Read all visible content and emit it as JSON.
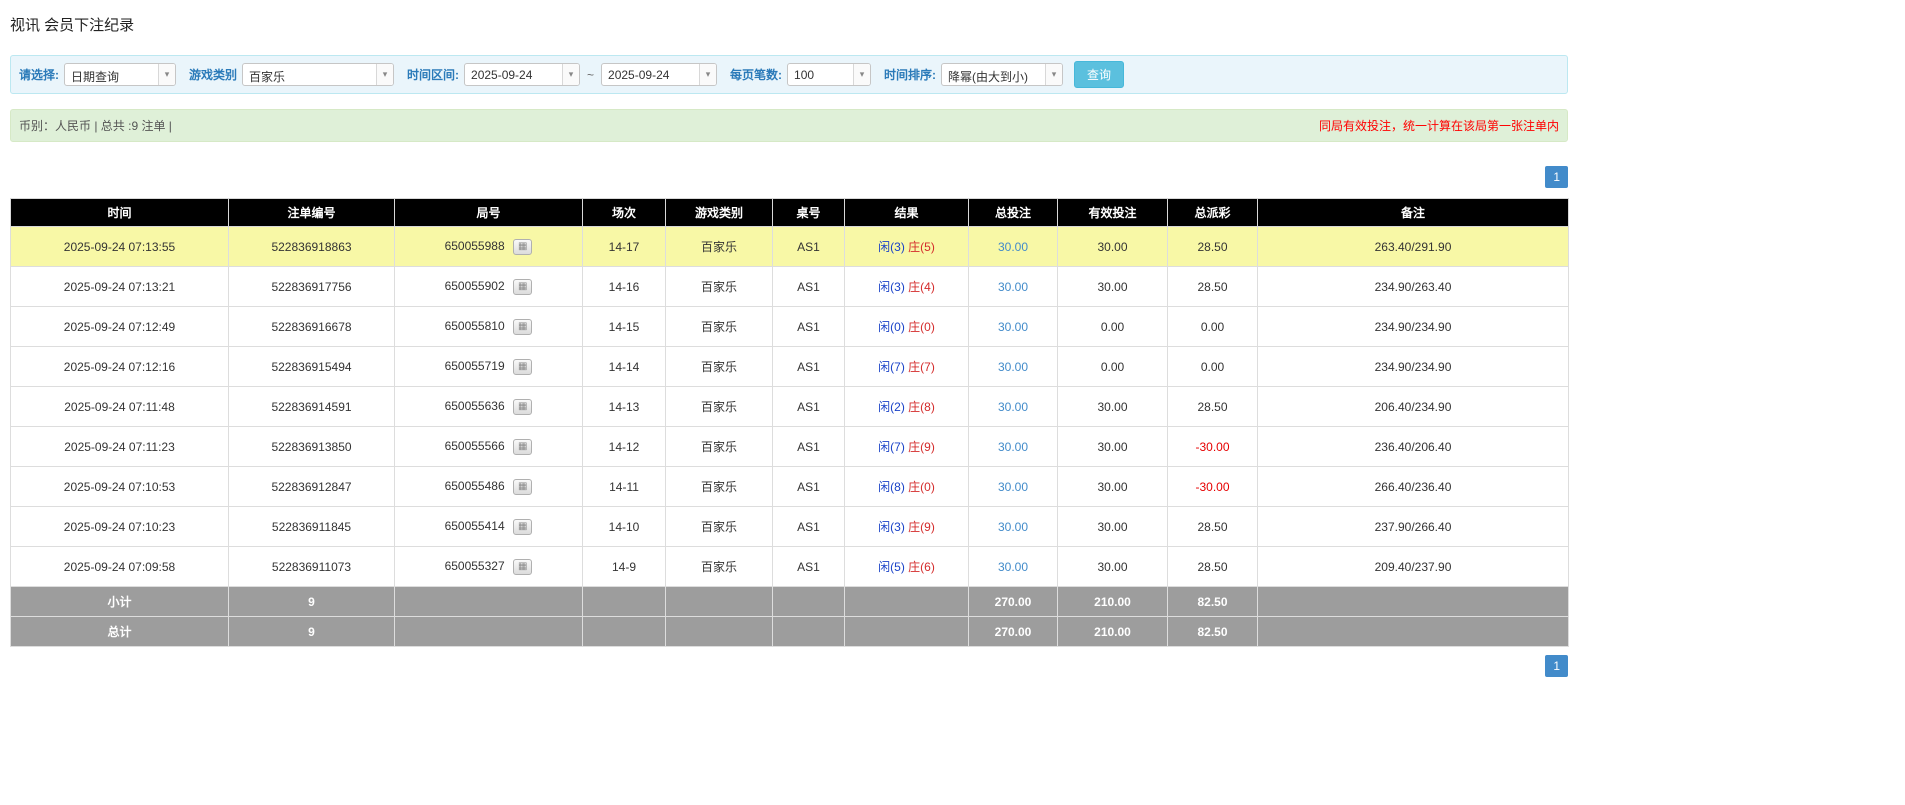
{
  "colors": {
    "accent": "#428bca",
    "button": "#5bc0de",
    "button_border": "#46b8da",
    "filter_bg": "#eaf5fb",
    "filter_border": "#bce8f1",
    "filter_label": "#2a7ab9",
    "summary_bg": "#dff0d8",
    "summary_border": "#d6e9c6",
    "note_red": "#ff0000",
    "highlight": "#f8f8a6",
    "player_blue": "#1a42c8",
    "banker_red": "#d42b2b",
    "footer_bg": "#9d9d9d",
    "header_bg": "#000000"
  },
  "page": {
    "title": "视讯 会员下注纪录"
  },
  "filters": {
    "select_label": "请选择:",
    "select_value": "日期查询",
    "game_type_label": "游戏类别",
    "game_type_value": "百家乐",
    "time_range_label": "时间区间:",
    "time_from": "2025-09-24",
    "range_separator": "~",
    "time_to": "2025-09-24",
    "page_size_label": "每页笔数:",
    "page_size_value": "100",
    "sort_label": "时间排序:",
    "sort_value": "降幂(由大到小)",
    "search_button": "查询"
  },
  "summary_bar": {
    "left": "币别：人民币 | 总共 :9 注单 |",
    "right": "同局有效投注，统一计算在该局第一张注单内"
  },
  "pagination": {
    "page": "1"
  },
  "table": {
    "headers": [
      "时间",
      "注单编号",
      "局号",
      "场次",
      "游戏类别",
      "桌号",
      "结果",
      "总投注",
      "有效投注",
      "总派彩",
      "备注"
    ],
    "rows": [
      {
        "time": "2025-09-24 07:13:55",
        "bet_id": "522836918863",
        "round_no": "650055988",
        "session": "14-17",
        "game_type": "百家乐",
        "table_no": "AS1",
        "result_player": "闲(3)",
        "result_banker": "庄(5)",
        "total_bet": "30.00",
        "valid_bet": "30.00",
        "payout": "28.50",
        "remark": "263.40/291.90",
        "highlight": true
      },
      {
        "time": "2025-09-24 07:13:21",
        "bet_id": "522836917756",
        "round_no": "650055902",
        "session": "14-16",
        "game_type": "百家乐",
        "table_no": "AS1",
        "result_player": "闲(3)",
        "result_banker": "庄(4)",
        "total_bet": "30.00",
        "valid_bet": "30.00",
        "payout": "28.50",
        "remark": "234.90/263.40",
        "highlight": false
      },
      {
        "time": "2025-09-24 07:12:49",
        "bet_id": "522836916678",
        "round_no": "650055810",
        "session": "14-15",
        "game_type": "百家乐",
        "table_no": "AS1",
        "result_player": "闲(0)",
        "result_banker": "庄(0)",
        "total_bet": "30.00",
        "valid_bet": "0.00",
        "payout": "0.00",
        "remark": "234.90/234.90",
        "highlight": false
      },
      {
        "time": "2025-09-24 07:12:16",
        "bet_id": "522836915494",
        "round_no": "650055719",
        "session": "14-14",
        "game_type": "百家乐",
        "table_no": "AS1",
        "result_player": "闲(7)",
        "result_banker": "庄(7)",
        "total_bet": "30.00",
        "valid_bet": "0.00",
        "payout": "0.00",
        "remark": "234.90/234.90",
        "highlight": false
      },
      {
        "time": "2025-09-24 07:11:48",
        "bet_id": "522836914591",
        "round_no": "650055636",
        "session": "14-13",
        "game_type": "百家乐",
        "table_no": "AS1",
        "result_player": "闲(2)",
        "result_banker": "庄(8)",
        "total_bet": "30.00",
        "valid_bet": "30.00",
        "payout": "28.50",
        "remark": "206.40/234.90",
        "highlight": false
      },
      {
        "time": "2025-09-24 07:11:23",
        "bet_id": "522836913850",
        "round_no": "650055566",
        "session": "14-12",
        "game_type": "百家乐",
        "table_no": "AS1",
        "result_player": "闲(7)",
        "result_banker": "庄(9)",
        "total_bet": "30.00",
        "valid_bet": "30.00",
        "payout": "-30.00",
        "remark": "236.40/206.40",
        "highlight": false
      },
      {
        "time": "2025-09-24 07:10:53",
        "bet_id": "522836912847",
        "round_no": "650055486",
        "session": "14-11",
        "game_type": "百家乐",
        "table_no": "AS1",
        "result_player": "闲(8)",
        "result_banker": "庄(0)",
        "total_bet": "30.00",
        "valid_bet": "30.00",
        "payout": "-30.00",
        "remark": "266.40/236.40",
        "highlight": false
      },
      {
        "time": "2025-09-24 07:10:23",
        "bet_id": "522836911845",
        "round_no": "650055414",
        "session": "14-10",
        "game_type": "百家乐",
        "table_no": "AS1",
        "result_player": "闲(3)",
        "result_banker": "庄(9)",
        "total_bet": "30.00",
        "valid_bet": "30.00",
        "payout": "28.50",
        "remark": "237.90/266.40",
        "highlight": false
      },
      {
        "time": "2025-09-24 07:09:58",
        "bet_id": "522836911073",
        "round_no": "650055327",
        "session": "14-9",
        "game_type": "百家乐",
        "table_no": "AS1",
        "result_player": "闲(5)",
        "result_banker": "庄(6)",
        "total_bet": "30.00",
        "valid_bet": "30.00",
        "payout": "28.50",
        "remark": "209.40/237.90",
        "highlight": false
      }
    ],
    "subtotal": {
      "label": "小计",
      "count": "9",
      "total_bet": "270.00",
      "valid_bet": "210.00",
      "payout": "82.50"
    },
    "total": {
      "label": "总计",
      "count": "9",
      "total_bet": "270.00",
      "valid_bet": "210.00",
      "payout": "82.50"
    }
  }
}
